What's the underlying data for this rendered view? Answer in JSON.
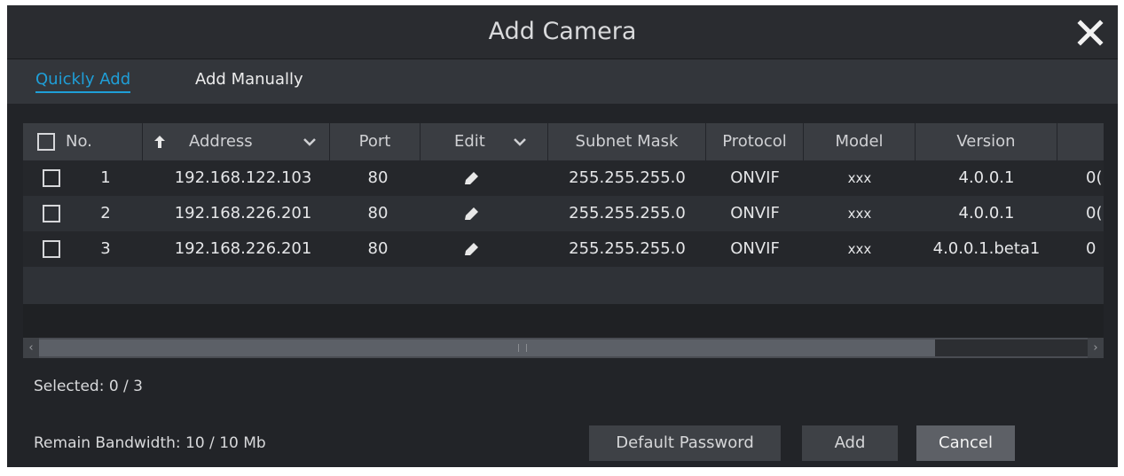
{
  "dialog": {
    "title": "Add Camera"
  },
  "tabs": [
    {
      "label": "Quickly Add",
      "active": true
    },
    {
      "label": "Add Manually",
      "active": false
    }
  ],
  "table": {
    "columns": {
      "no": "No.",
      "address": "Address",
      "port": "Port",
      "edit": "Edit",
      "subnet": "Subnet Mask",
      "protocol": "Protocol",
      "model": "Model",
      "version": "Version"
    },
    "rows": [
      {
        "no": "1",
        "address": "192.168.122.103",
        "port": "80",
        "subnet": "255.255.255.0",
        "protocol": "ONVIF",
        "model": "xxx",
        "version": "4.0.0.1",
        "extra": "0("
      },
      {
        "no": "2",
        "address": "192.168.226.201",
        "port": "80",
        "subnet": "255.255.255.0",
        "protocol": "ONVIF",
        "model": "xxx",
        "version": "4.0.0.1",
        "extra": "0("
      },
      {
        "no": "3",
        "address": "192.168.226.201",
        "port": "80",
        "subnet": "255.255.255.0",
        "protocol": "ONVIF",
        "model": "xxx",
        "version": "4.0.0.1.beta1",
        "extra": "0"
      }
    ]
  },
  "status": {
    "selected": "Selected: 0 / 3",
    "bandwidth": "Remain Bandwidth: 10 / 10 Mb"
  },
  "buttons": {
    "default_password": "Default Password",
    "add": "Add",
    "cancel": "Cancel"
  },
  "colors": {
    "accent": "#1f9fd8",
    "background": "#222428",
    "header": "#3a3d42"
  },
  "icons": {
    "close": "close-icon",
    "sort": "sort-arrow-up-icon",
    "dropdown": "chevron-down-icon",
    "edit": "pencil-icon"
  }
}
